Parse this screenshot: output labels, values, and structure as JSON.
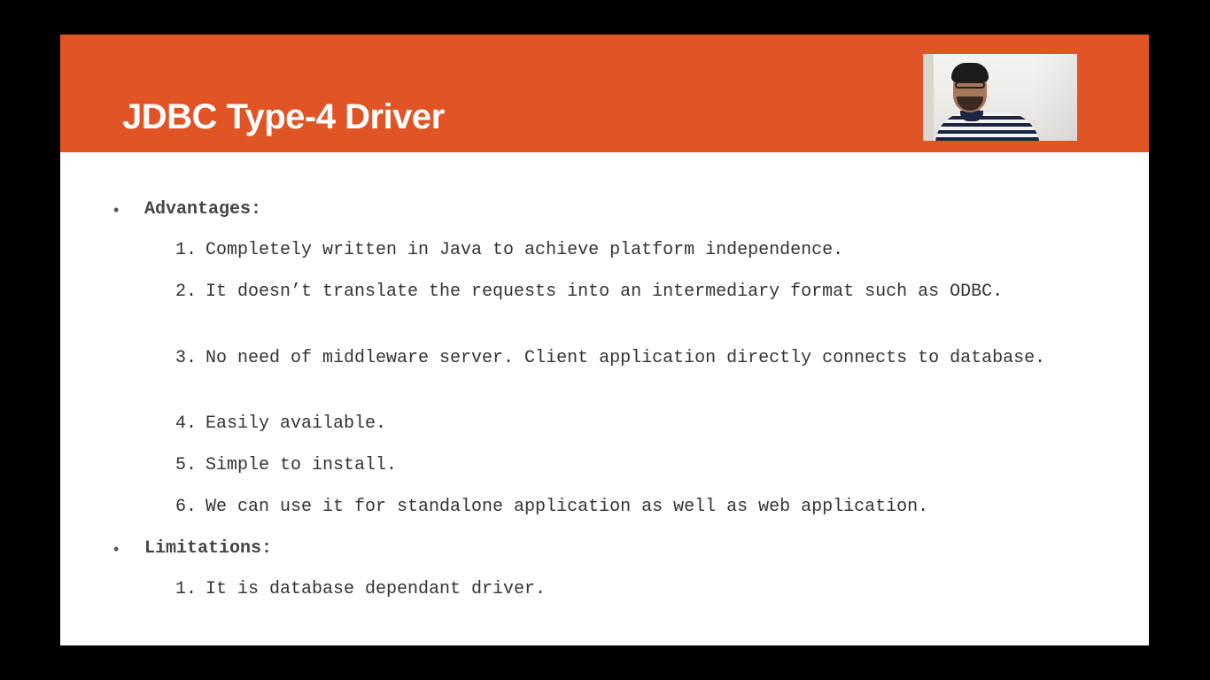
{
  "slide": {
    "title": "JDBC Type-4 Driver",
    "header_color": "#e05426",
    "sections": [
      {
        "heading": "Advantages:",
        "items": [
          {
            "num": "1.",
            "text": "Completely written in Java to achieve platform independence."
          },
          {
            "num": "2.",
            "text": "It doesn’t translate the requests into an intermediary format such as ODBC."
          },
          {
            "num": "3.",
            "text": "No need of middleware server. Client application directly connects to database."
          },
          {
            "num": "4.",
            "text": "Easily available."
          },
          {
            "num": "5.",
            "text": "Simple to install."
          },
          {
            "num": "6.",
            "text": "We can use it for standalone application as well as web application."
          }
        ]
      },
      {
        "heading": "Limitations:",
        "items": [
          {
            "num": "1.",
            "text": "It is database dependant driver."
          }
        ]
      }
    ]
  },
  "webcam": {
    "icon": "presenter-video-thumbnail"
  }
}
